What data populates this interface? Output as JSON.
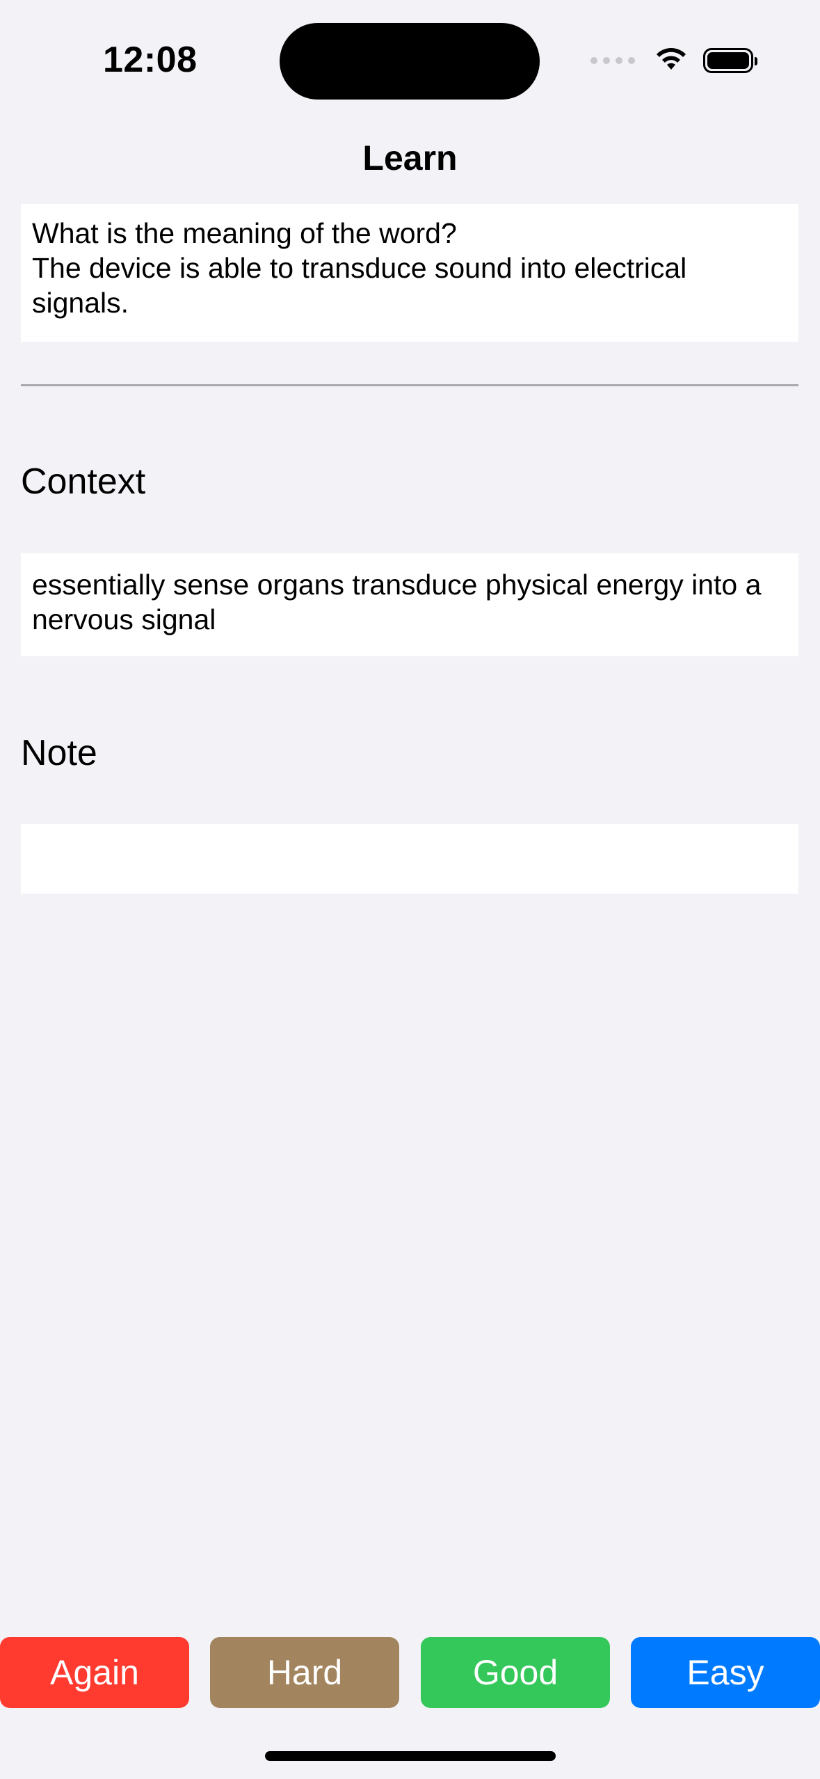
{
  "status_bar": {
    "time": "12:08",
    "icons": [
      "cellular-signal-icon",
      "wifi-icon",
      "battery-icon"
    ]
  },
  "nav": {
    "title": "Learn"
  },
  "card": {
    "question_prompt": "What is the meaning of the word?",
    "question_sentence": "The device is able to transduce sound into electrical signals.",
    "context_label": "Context",
    "context_text": "essentially sense organs transduce physical energy into a nervous signal",
    "note_label": "Note",
    "note_text": ""
  },
  "answer_buttons": [
    {
      "label": "Again",
      "color": "#ff3b30"
    },
    {
      "label": "Hard",
      "color": "#a2845e"
    },
    {
      "label": "Good",
      "color": "#34c759"
    },
    {
      "label": "Easy",
      "color": "#007aff"
    }
  ]
}
